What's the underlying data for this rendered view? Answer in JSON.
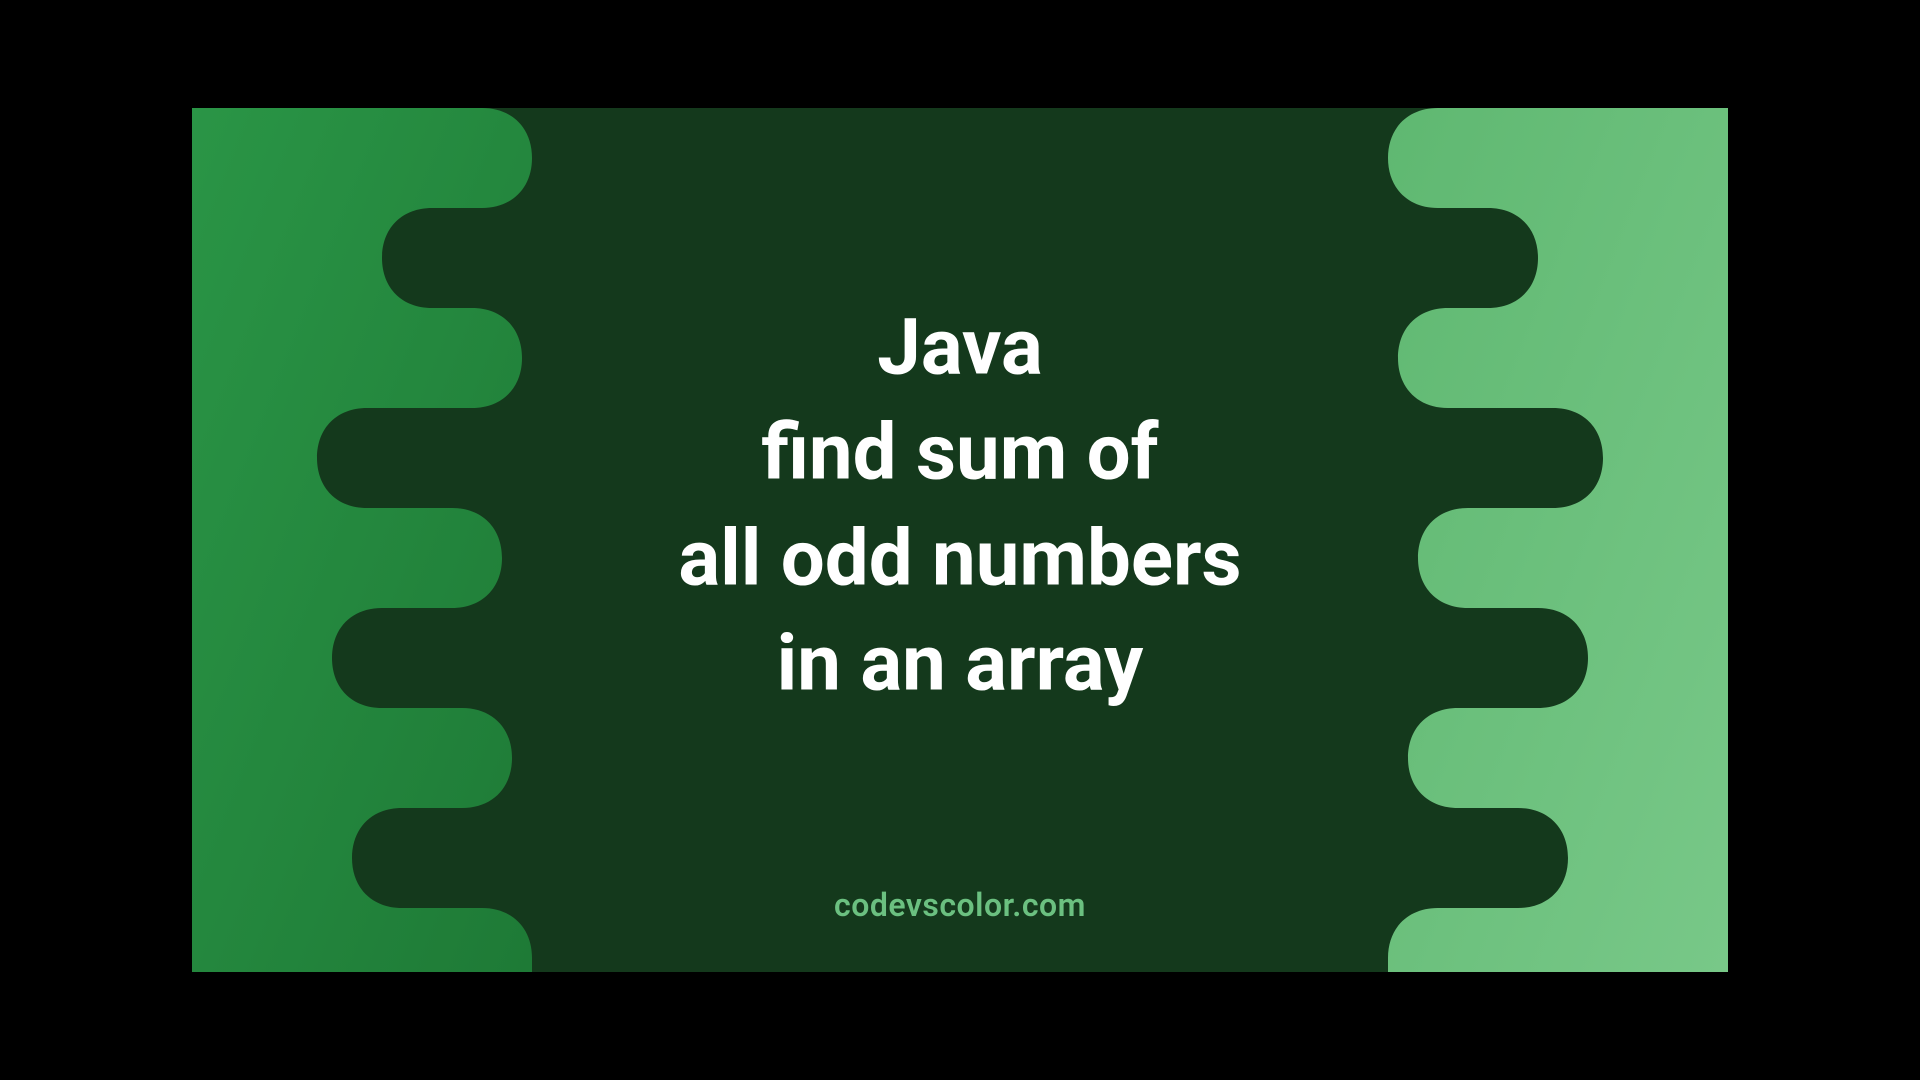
{
  "title": {
    "line1": "Java",
    "line2": "find sum of",
    "line3": "all odd numbers",
    "line4": "in an array"
  },
  "footer": "codevscolor.com",
  "colors": {
    "dark_bg": "#14391c",
    "left_green_start": "#2a9546",
    "left_green_end": "#1e7a36",
    "right_green_start": "#5fb871",
    "right_green_end": "#78c888",
    "text": "#ffffff",
    "footer_text": "#6bc080"
  }
}
